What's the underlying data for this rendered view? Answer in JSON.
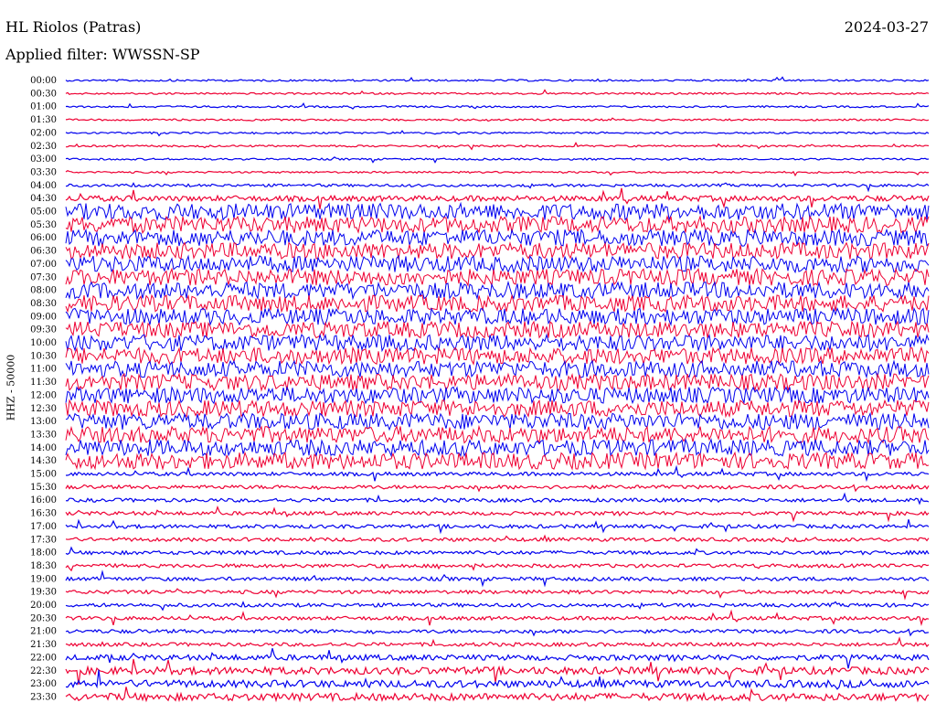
{
  "header": {
    "station": "HL Riolos (Patras)",
    "filter_text": "Applied filter: WWSSN-SP",
    "date": "2024-03-27"
  },
  "chart_data": {
    "type": "line",
    "title": "HL Riolos (Patras)",
    "ylabel": "HHZ - 50000",
    "colors": {
      "even_rows": "#0000ee",
      "odd_rows": "#ee0033"
    },
    "rows": [
      {
        "time": "00:00",
        "amplitude": 1
      },
      {
        "time": "00:30",
        "amplitude": 1
      },
      {
        "time": "01:00",
        "amplitude": 1
      },
      {
        "time": "01:30",
        "amplitude": 1
      },
      {
        "time": "02:00",
        "amplitude": 1
      },
      {
        "time": "02:30",
        "amplitude": 1
      },
      {
        "time": "03:00",
        "amplitude": 1
      },
      {
        "time": "03:30",
        "amplitude": 1
      },
      {
        "time": "04:00",
        "amplitude": 1.5
      },
      {
        "time": "04:30",
        "amplitude": 3
      },
      {
        "time": "05:00",
        "amplitude": 9
      },
      {
        "time": "05:30",
        "amplitude": 9
      },
      {
        "time": "06:00",
        "amplitude": 9
      },
      {
        "time": "06:30",
        "amplitude": 9
      },
      {
        "time": "07:00",
        "amplitude": 9
      },
      {
        "time": "07:30",
        "amplitude": 9
      },
      {
        "time": "08:00",
        "amplitude": 9
      },
      {
        "time": "08:30",
        "amplitude": 9
      },
      {
        "time": "09:00",
        "amplitude": 9
      },
      {
        "time": "09:30",
        "amplitude": 9
      },
      {
        "time": "10:00",
        "amplitude": 9
      },
      {
        "time": "10:30",
        "amplitude": 9
      },
      {
        "time": "11:00",
        "amplitude": 9
      },
      {
        "time": "11:30",
        "amplitude": 9
      },
      {
        "time": "12:00",
        "amplitude": 9
      },
      {
        "time": "12:30",
        "amplitude": 9
      },
      {
        "time": "13:00",
        "amplitude": 9
      },
      {
        "time": "13:30",
        "amplitude": 9
      },
      {
        "time": "14:00",
        "amplitude": 9
      },
      {
        "time": "14:30",
        "amplitude": 9
      },
      {
        "time": "15:00",
        "amplitude": 2
      },
      {
        "time": "15:30",
        "amplitude": 2
      },
      {
        "time": "16:00",
        "amplitude": 2
      },
      {
        "time": "16:30",
        "amplitude": 2
      },
      {
        "time": "17:00",
        "amplitude": 2
      },
      {
        "time": "17:30",
        "amplitude": 2
      },
      {
        "time": "18:00",
        "amplitude": 2
      },
      {
        "time": "18:30",
        "amplitude": 2
      },
      {
        "time": "19:00",
        "amplitude": 2
      },
      {
        "time": "19:30",
        "amplitude": 2
      },
      {
        "time": "20:00",
        "amplitude": 2
      },
      {
        "time": "20:30",
        "amplitude": 2
      },
      {
        "time": "21:00",
        "amplitude": 2
      },
      {
        "time": "21:30",
        "amplitude": 2
      },
      {
        "time": "22:00",
        "amplitude": 3
      },
      {
        "time": "22:30",
        "amplitude": 4
      },
      {
        "time": "23:00",
        "amplitude": 4
      },
      {
        "time": "23:30",
        "amplitude": 4
      }
    ]
  }
}
